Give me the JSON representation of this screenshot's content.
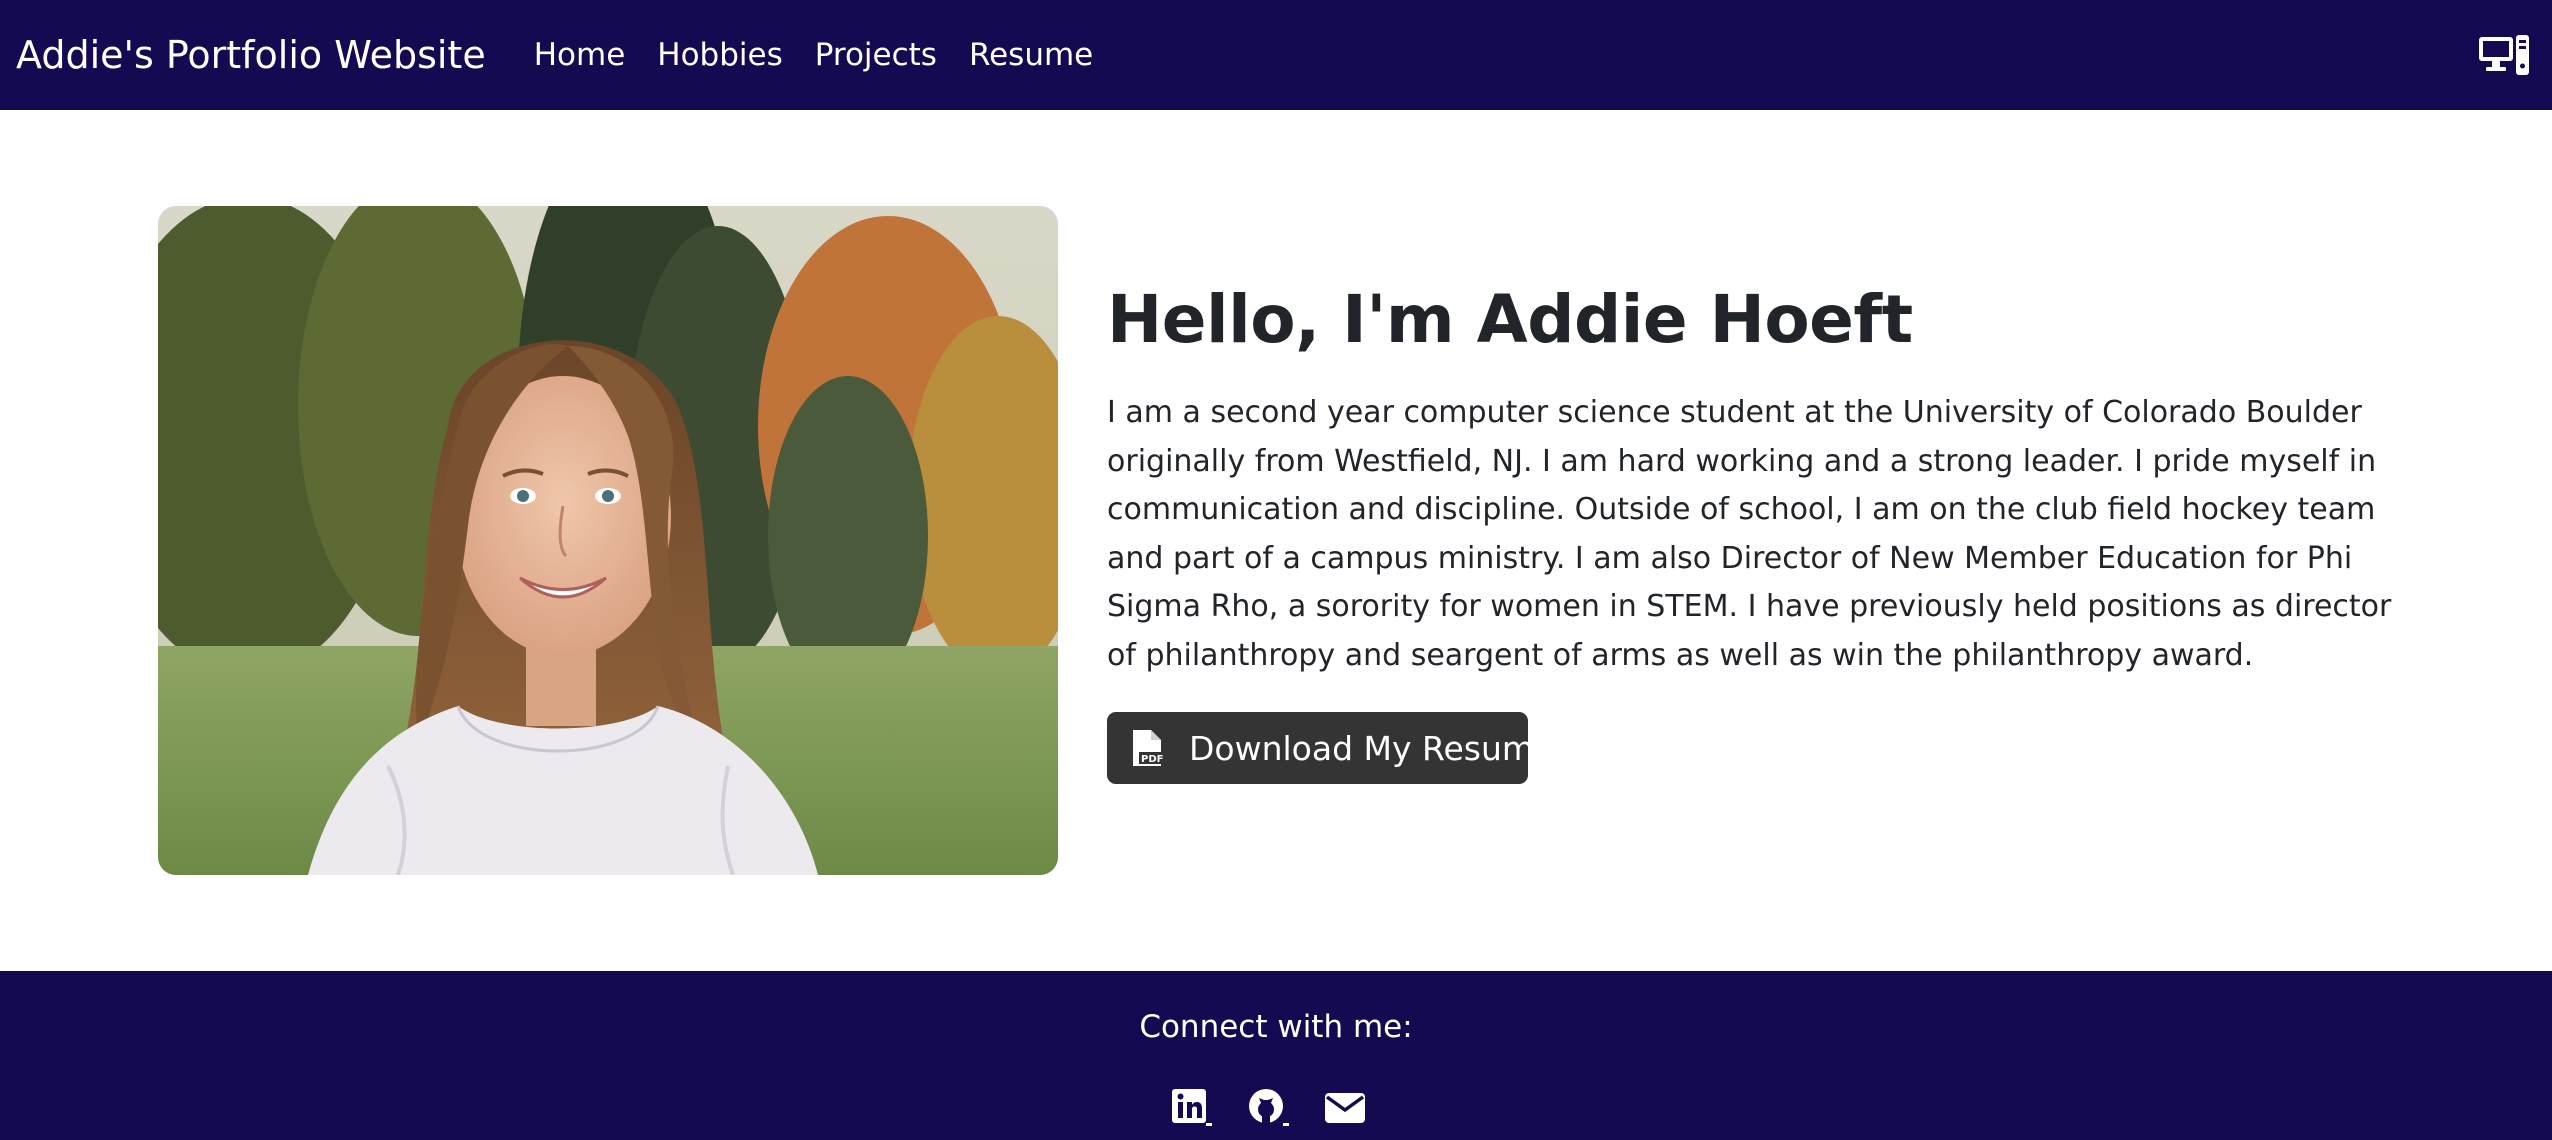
{
  "navbar": {
    "brand": "Addie's Portfolio Website",
    "links": [
      "Home",
      "Hobbies",
      "Projects",
      "Resume"
    ],
    "right_icon": "desktop-computer-icon",
    "background": "#130a52"
  },
  "hero": {
    "photo_alt": "Portrait of Addie Hoeft",
    "title": "Hello, I'm Addie Hoeft",
    "bio": "I am a second year computer science student at the University of Colorado Boulder originally from Westfield, NJ. I am hard working and a strong leader. I pride myself in communication and discipline. Outside of school, I am on the club field hockey team and part of a campus ministry. I am also Director of New Member Education for Phi Sigma Rho, a sorority for women in STEM. I have previously held positions as director of philanthropy and seargent of arms as well as win the philanthropy award.",
    "resume_button": "Download My Resume",
    "resume_icon": "pdf-file-icon",
    "button_color": "#343434"
  },
  "footer": {
    "connect_label": "Connect with me:",
    "social_icons": [
      "linkedin-icon",
      "github-icon",
      "email-icon"
    ],
    "background": "#130a52"
  }
}
